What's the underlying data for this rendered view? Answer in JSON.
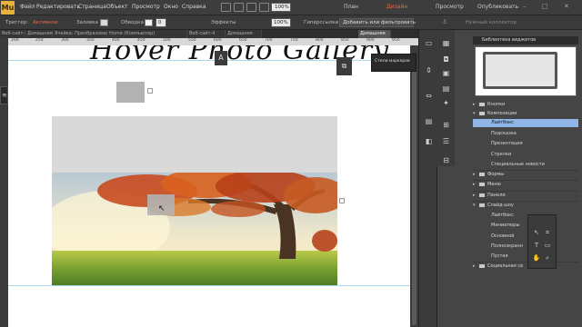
{
  "app": {
    "logo": "Mu"
  },
  "menu": [
    "Файл",
    "Редактировать",
    "Страница",
    "Объект",
    "Просмотр",
    "Окно",
    "Справка"
  ],
  "zoom": "100%",
  "workspace": {
    "plan": "План",
    "design": "Дизайн",
    "preview": "Просмотр",
    "publish": "Опубликовать"
  },
  "control_bar": {
    "trigger_label": "Триггер:",
    "trigger_value": "Активное",
    "fill_label": "Заливка",
    "stroke_label": "Обводка",
    "stroke_value": "0",
    "effects_label": "Эффекты",
    "opacity_value": "100%",
    "hyperlinks_label": "Гиперссылки",
    "hyperlink_placeholder": "Добавить или фильтровать",
    "pin_label": "Нужный коллектор"
  },
  "tabs": [
    "Веб-сайт-1",
    "Домашняя",
    "Ячейка: Преобразовани",
    "Home (Компьютер)",
    "Веб-сайт-4",
    "Домашняя",
    "Домашняя"
  ],
  "ruler_ticks": [
    "200",
    "250",
    "300",
    "350",
    "400",
    "450",
    "500",
    "550",
    "600",
    "650",
    "700",
    "750",
    "800",
    "850",
    "900",
    "950"
  ],
  "canvas": {
    "heading": "Hover Photo Gallery"
  },
  "tooltip": "Стили маркеров",
  "library": {
    "title": "Библиотека виджетов",
    "items": [
      {
        "label": "Кнопки",
        "type": "folder"
      },
      {
        "label": "Композиции",
        "type": "folder-open"
      },
      {
        "label": "Лайтбокс",
        "type": "item",
        "selected": true
      },
      {
        "label": "Подсказка",
        "type": "item"
      },
      {
        "label": "Презентация",
        "type": "item"
      },
      {
        "label": "Стрелки",
        "type": "item"
      },
      {
        "label": "Специальные новости",
        "type": "item"
      },
      {
        "label": "Формы",
        "type": "folder"
      },
      {
        "label": "Меню",
        "type": "folder"
      },
      {
        "label": "Панели",
        "type": "folder"
      },
      {
        "label": "Слайд-шоу",
        "type": "folder-open"
      },
      {
        "label": "Лайтбокс",
        "type": "item"
      },
      {
        "label": "Миниатюры",
        "type": "item"
      },
      {
        "label": "Основной",
        "type": "item"
      },
      {
        "label": "Полноэкранн",
        "type": "item"
      },
      {
        "label": "Пустая",
        "type": "item"
      },
      {
        "label": "Социальная се",
        "type": "folder"
      }
    ]
  },
  "colors": {
    "accent": "#e8b23c",
    "selection": "#8fb6e6",
    "active_text": "#e36a4d",
    "chrome": "#3d3d3d"
  },
  "icons": [
    "layers-icon",
    "text-icon",
    "library-icon",
    "zoom-icon",
    "pointer-icon",
    "hand-icon",
    "crop-icon",
    "rect-icon",
    "text-tool-icon"
  ]
}
